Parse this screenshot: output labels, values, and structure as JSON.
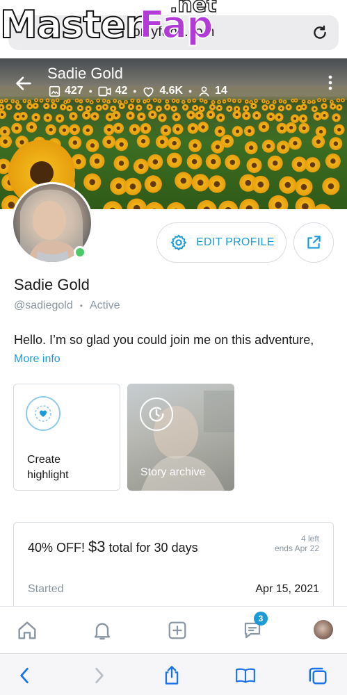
{
  "browser": {
    "url": "onlyfans.com",
    "watermark": {
      "part1": "Master",
      "part2": "Fap",
      "part3": ".net"
    }
  },
  "cover": {
    "name": "Sadie Gold",
    "stats": {
      "photos": "427",
      "videos": "42",
      "likes": "4.6K",
      "fans": "14"
    }
  },
  "profile": {
    "name": "Sadie Gold",
    "handle": "@sadiegold",
    "status": "Active",
    "bio": "Hello. I’m so glad you could join me on this adventure,",
    "more_info": "More info",
    "edit_label": "EDIT PROFILE"
  },
  "highlights": {
    "create_label_line1": "Create",
    "create_label_line2": "highlight",
    "archive_label": "Story archive"
  },
  "subscription": {
    "title_prefix": "40% OFF! ",
    "price": "$3",
    "title_suffix": " total for 30 days",
    "left": "4 left",
    "ends": "ends Apr 22",
    "started_label": "Started",
    "started_date": "Apr 15, 2021"
  },
  "nav": {
    "messages_badge": "3"
  },
  "colors": {
    "accent": "#1d9bd7",
    "online": "#4cc966",
    "muted": "#8a96a3"
  },
  "icons": [
    "back-arrow-icon",
    "photo-icon",
    "video-icon",
    "heart-icon",
    "fans-icon",
    "more-icon",
    "settings-gear-icon",
    "share-icon",
    "highlight-heart-icon",
    "history-clock-icon",
    "home-icon",
    "bell-icon",
    "add-post-icon",
    "messages-icon",
    "reload-icon",
    "safari-back-icon",
    "safari-forward-icon",
    "safari-share-icon",
    "bookmarks-icon",
    "tabs-icon"
  ]
}
